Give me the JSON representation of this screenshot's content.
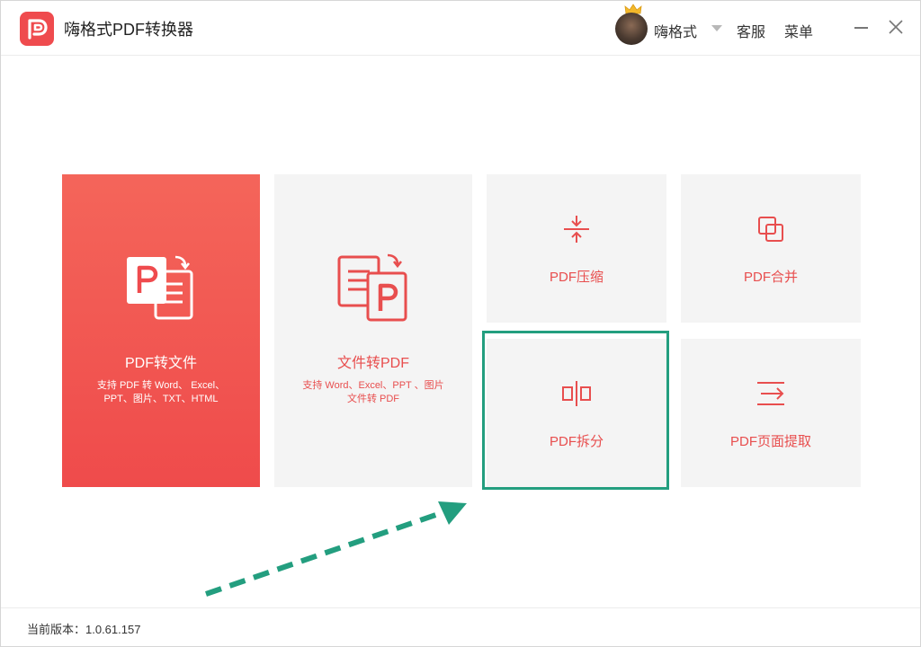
{
  "app": {
    "title": "嗨格式PDF转换器",
    "accent_color": "#ef4b4e"
  },
  "header": {
    "username": "嗨格式",
    "service_label": "客服",
    "menu_label": "菜单"
  },
  "cards": {
    "pdf_to_file": {
      "title": "PDF转文件",
      "desc": "支持 PDF 转 Word、 Excel、PPT、图片、TXT、HTML",
      "icon": "pdf-to-file-icon"
    },
    "file_to_pdf": {
      "title": "文件转PDF",
      "desc": "支持 Word、Excel、PPT 、图片文件转 PDF",
      "icon": "file-to-pdf-icon"
    },
    "compress": {
      "label": "PDF压缩",
      "icon": "compress-icon"
    },
    "merge": {
      "label": "PDF合并",
      "icon": "merge-icon"
    },
    "split": {
      "label": "PDF拆分",
      "icon": "split-icon"
    },
    "extract": {
      "label": "PDF页面提取",
      "icon": "extract-icon"
    }
  },
  "annotation": {
    "highlight_color": "#239e7f",
    "highlighted_card": "split"
  },
  "footer": {
    "version_label": "当前版本：1.0.61.157"
  }
}
